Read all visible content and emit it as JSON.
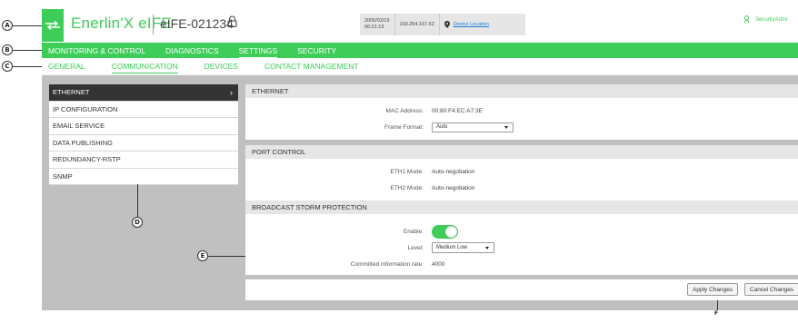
{
  "callouts": {
    "a": "A",
    "b": "B",
    "c": "C",
    "d": "D",
    "e": "E",
    "f": "F"
  },
  "header": {
    "brand": "Enerlin'X eIFE",
    "device_name": "eIFE-021234",
    "date": "2000/02/19",
    "time": "06:21:13",
    "ip": "169.254.167.62",
    "location_link": "Device Location",
    "user": "SecurityAdmi",
    "icons": {
      "logo": "exchange-arrows-icon",
      "lock": "lock-icon",
      "location": "map-pin-icon",
      "user": "user-icon"
    }
  },
  "main_nav": {
    "items": [
      {
        "label": "MONITORING & CONTROL"
      },
      {
        "label": "DIAGNOSTICS"
      },
      {
        "label": "SETTINGS"
      },
      {
        "label": "SECURITY"
      }
    ],
    "active": "SETTINGS"
  },
  "sub_nav": {
    "items": [
      {
        "label": "GENERAL"
      },
      {
        "label": "COMMUNICATION"
      },
      {
        "label": "DEVICES"
      },
      {
        "label": "CONTACT MANAGEMENT"
      }
    ],
    "active": "COMMUNICATION"
  },
  "side_menu": {
    "items": [
      {
        "label": "ETHERNET"
      },
      {
        "label": "IP CONFIGURATION"
      },
      {
        "label": "EMAIL SERVICE"
      },
      {
        "label": "DATA PUBLISHING"
      },
      {
        "label": "REDUNDANCY-RSTP"
      },
      {
        "label": "SNMP"
      }
    ],
    "active": "ETHERNET",
    "chevron": "›"
  },
  "ethernet": {
    "title": "ETHERNET",
    "mac_label": "MAC Address:",
    "mac_value": "00:80:F4:EC:A7:3E",
    "frame_label": "Frame Format:",
    "frame_value": "Auto"
  },
  "port_control": {
    "title": "PORT CONTROL",
    "eth1_label": "ETH1 Mode:",
    "eth1_value": "Auto-negotiation",
    "eth2_label": "ETH2 Mode:",
    "eth2_value": "Auto-negotiation"
  },
  "storm": {
    "title": "BROADCAST STORM PROTECTION",
    "enable_label": "Enable:",
    "enabled": true,
    "level_label": "Level:",
    "level_value": "Medium Low",
    "cir_label": "Committed information rate:",
    "cir_value": "4000"
  },
  "actions": {
    "apply": "Apply Changes",
    "cancel": "Cancel Changes"
  },
  "colors": {
    "accent": "#3dcd58",
    "dark": "#333333",
    "content_bg": "#c0c0c0",
    "link": "#1a7bd6"
  }
}
